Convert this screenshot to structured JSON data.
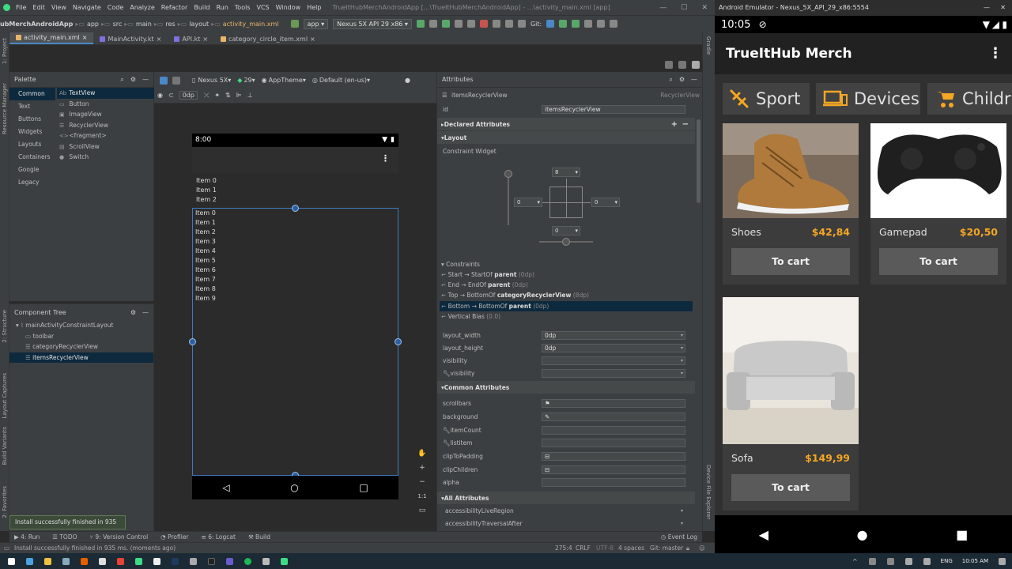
{
  "ide": {
    "menu": [
      "File",
      "Edit",
      "View",
      "Navigate",
      "Code",
      "Analyze",
      "Refactor",
      "Build",
      "Run",
      "Tools",
      "VCS",
      "Window",
      "Help"
    ],
    "window_title": "TrueItHubMerchAndroidApp [...\\TrueItHubMerchAndroidApp] - ...\\activity_main.xml [app]",
    "breadcrumbs": [
      "ubMerchAndroidApp",
      "app",
      "src",
      "main",
      "res",
      "layout",
      "activity_main.xml"
    ],
    "run_config": "app",
    "device_config": "Nexus 5X API 29 x86",
    "git_label": "Git:",
    "file_tabs": [
      "activity_main.xml",
      "MainActivity.kt",
      "API.kt",
      "category_circle_item.xml"
    ],
    "left_strip": [
      "1: Project",
      "Resource Manager",
      "2: Structure",
      "Layout Captures",
      "Build Variants",
      "2: Favorites"
    ],
    "right_strip": [
      "Gradle",
      "Device File Explorer"
    ],
    "palette": {
      "title": "Palette",
      "categories": [
        "Common",
        "Text",
        "Buttons",
        "Widgets",
        "Layouts",
        "Containers",
        "Google",
        "Legacy"
      ],
      "items": [
        {
          "glyph": "Ab",
          "label": "TextView"
        },
        {
          "glyph": "▭",
          "label": "Button"
        },
        {
          "glyph": "▣",
          "label": "ImageView"
        },
        {
          "glyph": "☰",
          "label": "RecyclerView"
        },
        {
          "glyph": "<>",
          "label": "<fragment>"
        },
        {
          "glyph": "▤",
          "label": "ScrollView"
        },
        {
          "glyph": "●",
          "label": "Switch"
        }
      ]
    },
    "component_tree": {
      "title": "Component Tree",
      "root": "mainActivityConstraintLayout",
      "children": [
        "toolbar",
        "categoryRecyclerView",
        "itemsRecyclerView"
      ]
    },
    "design_toolbar": {
      "device": "Nexus 5X",
      "api": "29",
      "theme": "AppTheme",
      "locale": "Default (en-us)",
      "margin": "0dp"
    },
    "preview": {
      "time": "8:00",
      "list1": [
        "Item 0",
        "Item 1",
        "Item 2"
      ],
      "list2": [
        "Item 0",
        "Item 1",
        "Item 2",
        "Item 3",
        "Item 4",
        "Item 5",
        "Item 6",
        "Item 7",
        "Item 8",
        "Item 9"
      ]
    },
    "zoom_label": "1:1",
    "attributes": {
      "title": "Attributes",
      "selected_name": "itemsRecyclerView",
      "selected_type": "RecyclerView",
      "id_label": "id",
      "id_value": "itemsRecyclerView",
      "declared": "Declared Attributes",
      "layout": "Layout",
      "constraint_widget": "Constraint Widget",
      "cw_top": "8",
      "cw_left": "0",
      "cw_right": "0",
      "cw_bottom": "0",
      "constraints_title": "Constraints",
      "constraints": [
        {
          "pre": "Start → StartOf ",
          "bold": "parent",
          "post": " (0dp)"
        },
        {
          "pre": "End → EndOf ",
          "bold": "parent",
          "post": " (0dp)"
        },
        {
          "pre": "Top → BottomOf ",
          "bold": "categoryRecyclerView",
          "post": " (8dp)"
        },
        {
          "pre": "Bottom → BottomOf ",
          "bold": "parent",
          "post": " (0dp)"
        },
        {
          "pre": "Vertical Bias ",
          "bold": "",
          "post": " (0.0)"
        }
      ],
      "layout_rows": [
        {
          "label": "layout_width",
          "value": "0dp"
        },
        {
          "label": "layout_height",
          "value": "0dp"
        },
        {
          "label": "visibility",
          "value": ""
        },
        {
          "label": "visibility",
          "value": ""
        }
      ],
      "common": "Common Attributes",
      "common_rows": [
        {
          "label": "scrollbars",
          "value": ""
        },
        {
          "label": "background",
          "value": ""
        },
        {
          "label": "itemCount",
          "value": ""
        },
        {
          "label": "listitem",
          "value": ""
        },
        {
          "label": "clipToPadding",
          "value": ""
        },
        {
          "label": "clipChildren",
          "value": ""
        },
        {
          "label": "alpha",
          "value": ""
        }
      ],
      "all": "All Attributes",
      "all_rows": [
        "accessibilityLiveRegion",
        "accessibilityTraversalAfter"
      ]
    },
    "bottom_tabs": [
      "4: Run",
      "TODO",
      "9: Version Control",
      "Profiler",
      "6: Logcat",
      "Build"
    ],
    "event_log": "Event Log",
    "toast": "Install successfully finished in 935 ms.",
    "status": {
      "message": "Install successfully finished in 935 ms. (moments ago)",
      "position": "275:4",
      "line_sep": "CRLF",
      "encoding": "UTF-8",
      "indent": "4 spaces",
      "branch": "Git: master"
    }
  },
  "emulator": {
    "title": "Android Emulator - Nexus_5X_API_29_x86:5554",
    "time": "10:05",
    "app_title": "TrueItHub Merch",
    "categories": [
      {
        "icon": "sport-icon",
        "label": "Sport"
      },
      {
        "icon": "devices-icon",
        "label": "Devices"
      },
      {
        "icon": "stroller-icon",
        "label": "Childr"
      }
    ],
    "products": [
      {
        "name": "Shoes",
        "price": "$42,84",
        "button": "To cart"
      },
      {
        "name": "Gamepad",
        "price": "$20,50",
        "button": "To cart"
      },
      {
        "name": "Sofa",
        "price": "$149,99",
        "button": "To cart"
      }
    ]
  },
  "taskbar": {
    "lang": "ENG",
    "time": "10:05 AM"
  },
  "colors": {
    "accent": "#f5a623",
    "selection": "#0d293e",
    "link_blue": "#4a88c7"
  }
}
